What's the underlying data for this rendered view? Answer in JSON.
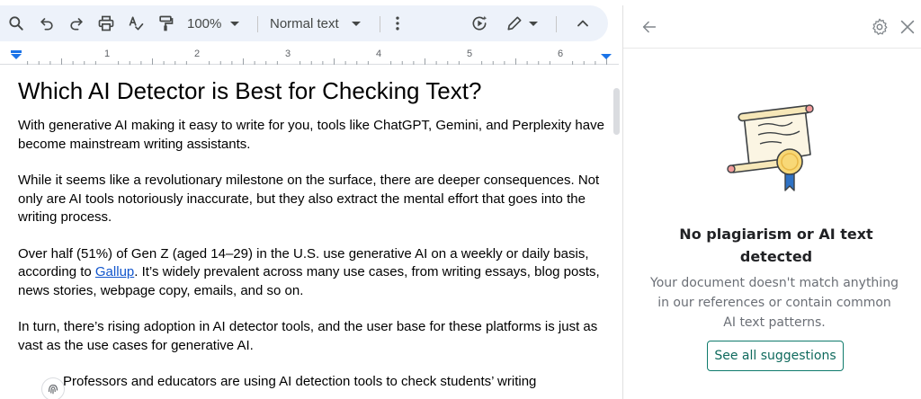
{
  "toolbar": {
    "zoom": "100%",
    "paragraph_style": "Normal text",
    "icons": [
      "search-icon",
      "undo-icon",
      "redo-icon",
      "print-icon",
      "spellcheck-icon",
      "paint-format-icon",
      "more-vert-icon",
      "gemini-icon",
      "pencil-edit-icon",
      "chevron-up-icon"
    ]
  },
  "ruler": {
    "numbers": [
      "1",
      "2",
      "3",
      "4",
      "5",
      "6"
    ]
  },
  "document": {
    "heading": "Which AI Detector is Best for Checking Text?",
    "p1": "With generative AI making it easy to write for you, tools like ChatGPT, Gemini, and Perplexity have become mainstream writing assistants.",
    "p2": "While it seems like a revolutionary milestone on the surface, there are deeper consequences. Not only are AI tools notoriously inaccurate, but they also extract the mental effort that goes into the writing process.",
    "p3_before": "Over half (51%) of Gen Z (aged 14–29) in the U.S. use generative AI on a weekly or daily basis, according to ",
    "p3_link": "Gallup",
    "p3_after": ". It’s widely prevalent across many use cases, from writing essays, blog posts, news stories, webpage copy, emails, and so on.",
    "p4": "In turn, there’s rising adoption in AI detector tools, and the user base for these platforms is just as vast as the use cases for generative AI.",
    "bullet1": "Professors and educators are using AI detection tools to check students’ writing"
  },
  "panel": {
    "title": "No plagiarism or AI text detected",
    "description": "Your document doesn't match anything in our references or contain common AI text patterns.",
    "button": "See all suggestions",
    "accent": "#0f7b6c"
  }
}
